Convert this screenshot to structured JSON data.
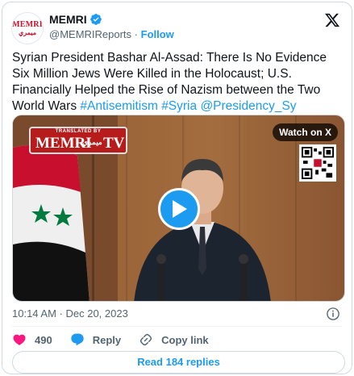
{
  "account": {
    "avatar_text_en": "MEMRI",
    "avatar_text_ar": "ميمري",
    "name": "MEMRI",
    "handle": "@MEMRIReports",
    "separator": "·",
    "follow_label": "Follow"
  },
  "tweet": {
    "text": "Syrian President Bashar Al-Assad: There Is No Evidence Six Million Jews Were Killed in the Holocaust; U.S. Financially Helped the Rise of Nazism between the Two World Wars",
    "hashtags": [
      "#Antisemitism",
      "#Syria",
      "@Presidency_Sy"
    ],
    "timestamp": "10:14 AM · Dec 20, 2023"
  },
  "media": {
    "badge_top": "TRANSLATED BY",
    "badge_memri": "MEMRI",
    "badge_ar": "ميمري",
    "badge_tv": "TV",
    "watch_label": "Watch on X"
  },
  "actions": {
    "like_count": "490",
    "reply_label": "Reply",
    "copy_link_label": "Copy link"
  },
  "replies_button": "Read 184 replies",
  "colors": {
    "accent": "#1d9bf0",
    "like": "#f91880",
    "text": "#0f1419",
    "muted": "#536471"
  }
}
